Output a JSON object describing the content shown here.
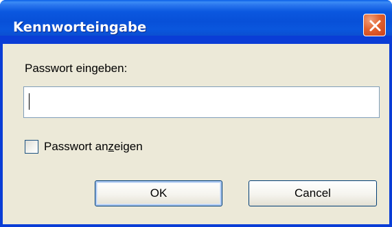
{
  "window": {
    "title": "Kennworteingabe"
  },
  "dialog": {
    "prompt_label": "Passwort eingeben:",
    "password_value": "",
    "show_password": {
      "label_before": "Passwort an",
      "label_underlined": "z",
      "label_after": "eigen",
      "checked": false
    },
    "ok_label": "OK",
    "cancel_label": "Cancel"
  },
  "icons": {
    "close": "close-icon"
  },
  "colors": {
    "titlebar": "#0a56dd",
    "client_background": "#ece9d8",
    "close_button": "#e2622f"
  }
}
